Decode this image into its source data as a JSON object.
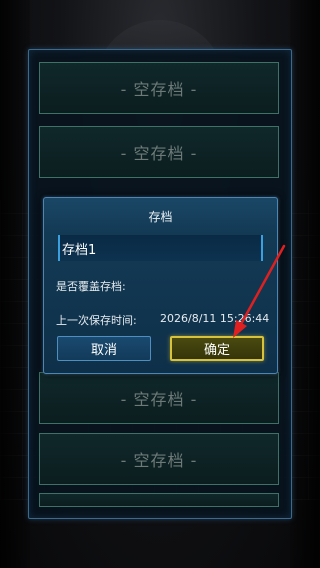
{
  "save_slots": [
    {
      "label": "- 空存档 -"
    },
    {
      "label": "- 空存档 -"
    },
    {
      "label": "- 空存档 -"
    },
    {
      "label": "- 空存档 -"
    }
  ],
  "dialog": {
    "title": "存档",
    "save_name_value": "存档1",
    "prompt": "是否覆盖存档:",
    "last_save_label": "上一次保存时间:",
    "last_save_value": "2026/8/11 15:26:44",
    "cancel_label": "取消",
    "confirm_label": "确定"
  },
  "colors": {
    "confirm_border": "#d8c23a",
    "annotation_arrow": "#e02020"
  }
}
